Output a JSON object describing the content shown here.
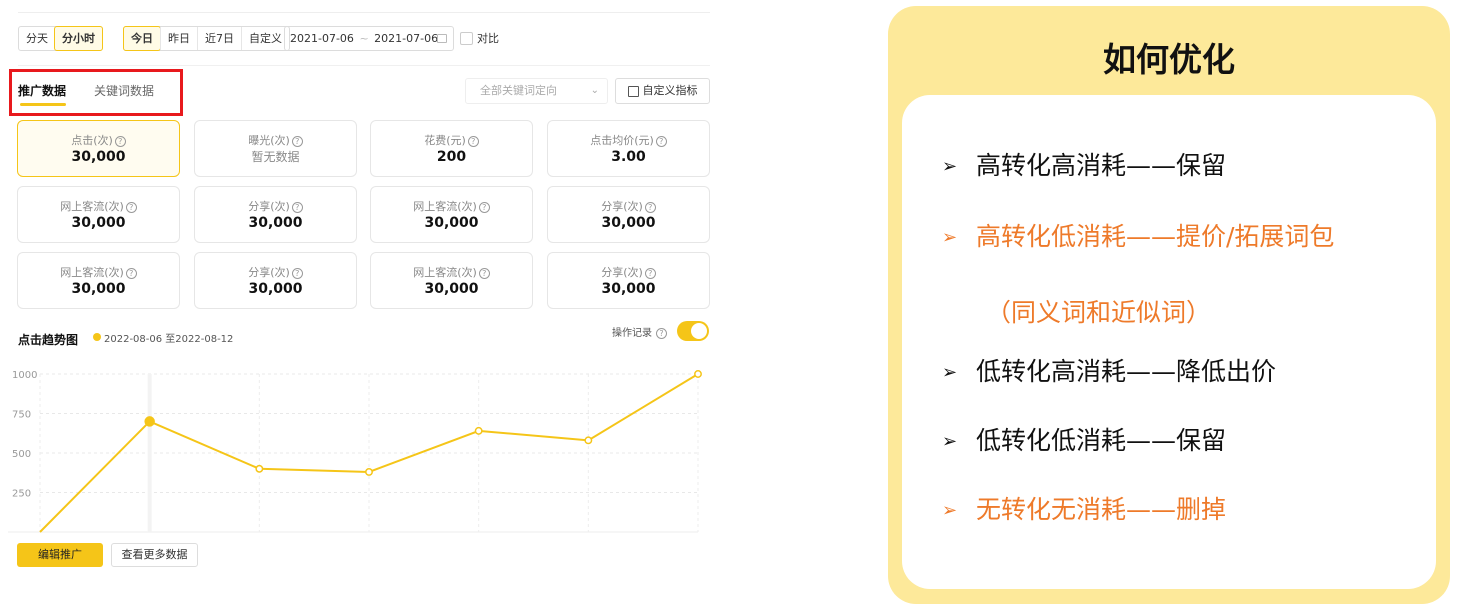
{
  "filters": {
    "granularity": [
      "分天",
      "分小时"
    ],
    "period": [
      "今日",
      "昨日",
      "近7日",
      "自定义"
    ],
    "date_start": "2021-07-06",
    "date_sep": "~",
    "date_end": "2021-07-06",
    "compare_label": "对比"
  },
  "tabs": [
    "推广数据",
    "关键词数据"
  ],
  "keyword_select_placeholder": "全部关键词定向",
  "custom_metric_label": "自定义指标",
  "metrics": [
    {
      "label": "点击(次)",
      "value": "30,000"
    },
    {
      "label": "曝光(次)",
      "value": "暂无数据"
    },
    {
      "label": "花费(元)",
      "value": "200"
    },
    {
      "label": "点击均价(元)",
      "value": "3.00"
    },
    {
      "label": "网上客流(次)",
      "value": "30,000"
    },
    {
      "label": "分享(次)",
      "value": "30,000"
    },
    {
      "label": "网上客流(次)",
      "value": "30,000"
    },
    {
      "label": "分享(次)",
      "value": "30,000"
    },
    {
      "label": "网上客流(次)",
      "value": "30,000"
    },
    {
      "label": "分享(次)",
      "value": "30,000"
    },
    {
      "label": "网上客流(次)",
      "value": "30,000"
    },
    {
      "label": "分享(次)",
      "value": "30,000"
    }
  ],
  "trend": {
    "title": "点击趋势图",
    "legend": "2022-08-06 至2022-08-12",
    "op_record_label": "操作记录"
  },
  "chart_data": {
    "type": "line",
    "x": [
      1,
      2,
      3,
      4,
      5,
      6,
      7
    ],
    "values": [
      0,
      700,
      400,
      380,
      640,
      580,
      1000
    ],
    "yticks": [
      1000,
      750,
      500,
      250
    ],
    "ylim": [
      0,
      1000
    ],
    "color": "#f5c518"
  },
  "buttons": {
    "edit": "编辑推广",
    "more": "查看更多数据"
  },
  "panel": {
    "title": "如何优化",
    "items": [
      {
        "text": "高转化高消耗——保留",
        "color": "#111111"
      },
      {
        "text": "高转化低消耗——提价/拓展词包",
        "color": "#ee7a2a"
      },
      {
        "text": "低转化高消耗——降低出价",
        "color": "#111111"
      },
      {
        "text": "低转化低消耗——保留",
        "color": "#111111"
      },
      {
        "text": "无转化无消耗——删掉",
        "color": "#ee7a2a"
      }
    ],
    "subline": "（同义词和近似词）",
    "arrow": "➢"
  }
}
